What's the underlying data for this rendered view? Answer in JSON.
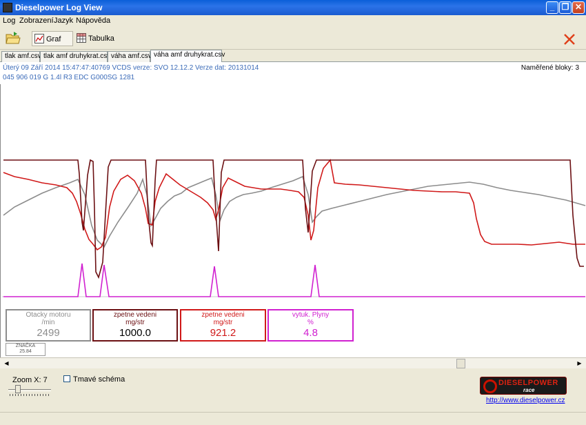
{
  "window": {
    "title": "Dieselpower Log View"
  },
  "menu": [
    {
      "label": "Log"
    },
    {
      "label": "Zobrazení"
    },
    {
      "label": "Jazyk"
    },
    {
      "label": "Nápověda"
    }
  ],
  "toolbar": {
    "graph_label": "Graf",
    "table_label": "Tabulka"
  },
  "tabs": [
    {
      "label": "tlak amf.csv"
    },
    {
      "label": "tlak amf druhykrat.csv"
    },
    {
      "label": "váha amf.csv"
    },
    {
      "label": "váha amf druhykrat.csv"
    }
  ],
  "info": {
    "line1": "Úterý 09 Září 2014 15:47:47:40769 VCDS verze: SVO 12.12.2 Verze dat: 20131014",
    "line2": "045 906 019 G  1.4l R3 EDC G000SG  1281",
    "blocks_label": "Naměřené bloky:",
    "blocks_value": "3"
  },
  "gauges": [
    {
      "name": "Otacky motoru",
      "unit": "/min",
      "value": "2499",
      "color": "#8c8c8c"
    },
    {
      "name": "zpetne vedeni",
      "unit": "mg/str",
      "value": "1000.0",
      "color": "#6b0f12"
    },
    {
      "name": "zpetne vedeni",
      "unit": "mg/str",
      "value": "921.2",
      "color": "#d01818"
    },
    {
      "name": "vytuk. Plyny",
      "unit": "%",
      "value": "4.8",
      "color": "#d020d0"
    }
  ],
  "marker": {
    "label": "ZNAČKA",
    "value": "25.84"
  },
  "bottom": {
    "zoom_label": "Zoom X:",
    "zoom_value": "7",
    "dark_scheme_label": "Tmavé schéma",
    "logo_text": "DIESELPOWER",
    "logo_sub": "race engineering",
    "website": "http://www.dieselpower.cz"
  },
  "colors": {
    "series_gray": "#8c8c8c",
    "series_dark_red": "#6b0f12",
    "series_red": "#d01818",
    "series_magenta": "#d020d0"
  }
}
